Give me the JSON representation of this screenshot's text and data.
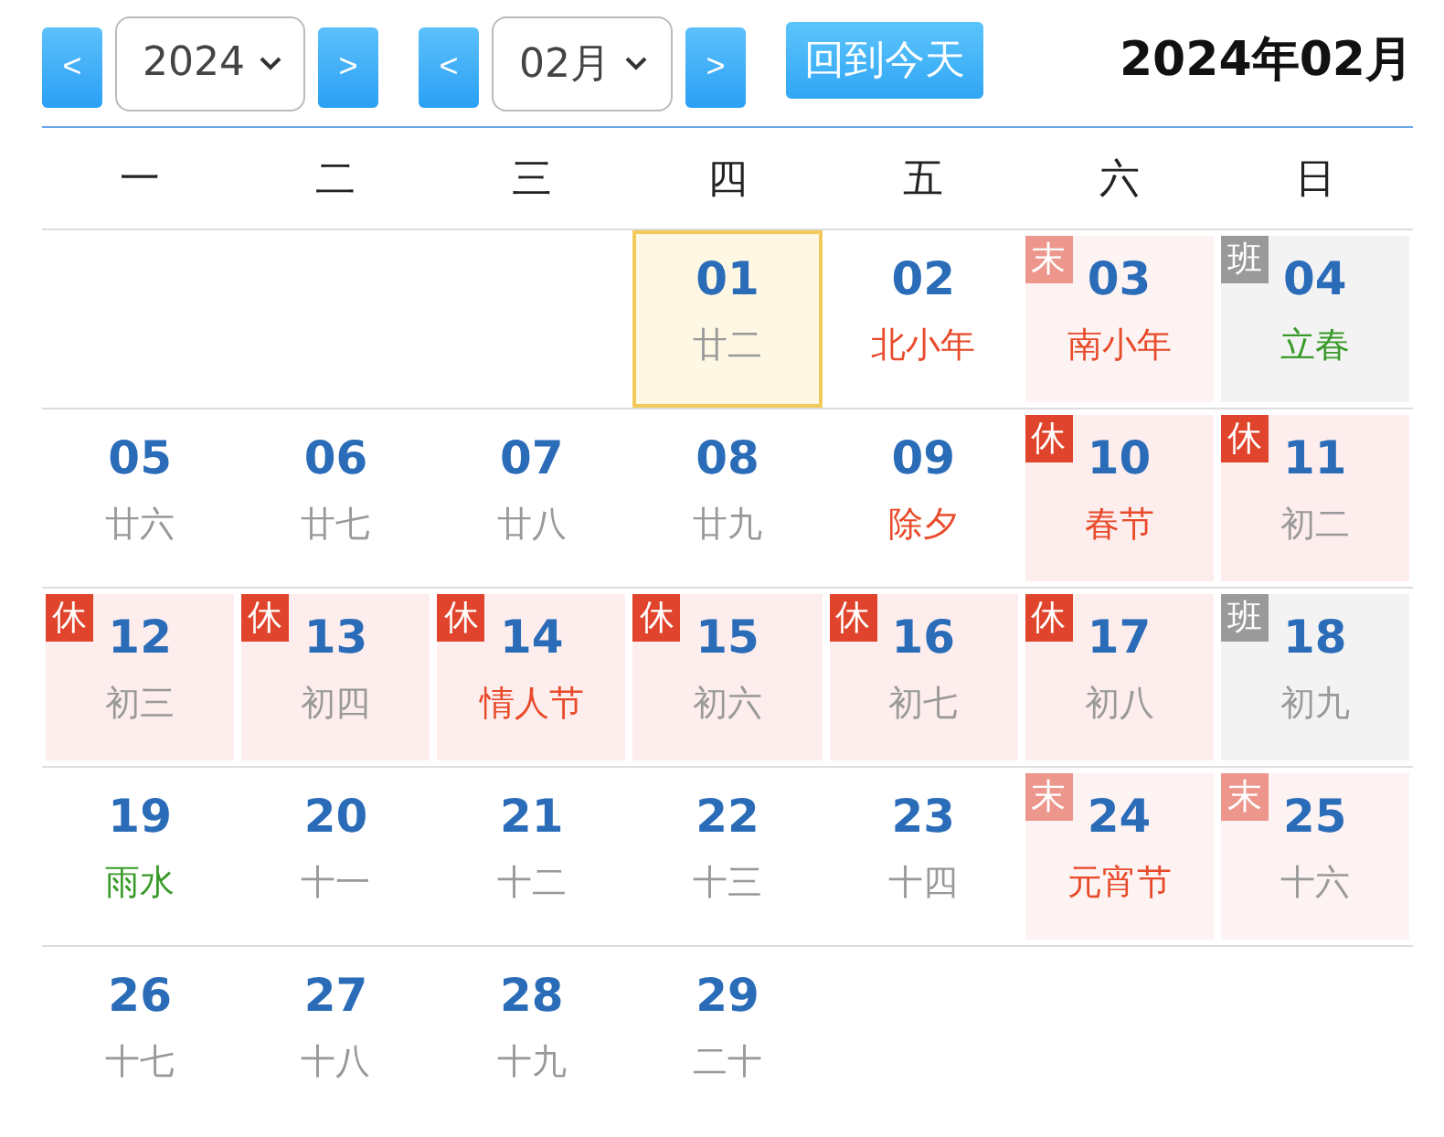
{
  "toolbar": {
    "year_select": {
      "value": "2024"
    },
    "month_select": {
      "value": "02月"
    },
    "prev_label": "<",
    "next_label": ">",
    "today_button": "回到今天",
    "heading": "2024年02月"
  },
  "weekdays": [
    "一",
    "二",
    "三",
    "四",
    "五",
    "六",
    "日"
  ],
  "weeks": [
    [
      {
        "date": "01",
        "sub": {
          "text": "廿二",
          "kind": "lunar"
        },
        "kind": "normal",
        "selected": true
      },
      {
        "date": "02",
        "sub": {
          "text": "北小年",
          "kind": "festival"
        },
        "kind": "normal",
        "selected": false
      },
      {
        "date": "03",
        "sub": {
          "text": "南小年",
          "kind": "festival"
        },
        "kind": "weekend",
        "badge": "末",
        "selected": false
      },
      {
        "date": "04",
        "sub": {
          "text": "立春",
          "kind": "term"
        },
        "kind": "work",
        "badge": "班",
        "selected": false
      }
    ],
    [
      {
        "date": "05",
        "sub": {
          "text": "廿六",
          "kind": "lunar"
        },
        "kind": "normal",
        "selected": false
      },
      {
        "date": "06",
        "sub": {
          "text": "廿七",
          "kind": "lunar"
        },
        "kind": "normal",
        "selected": false
      },
      {
        "date": "07",
        "sub": {
          "text": "廿八",
          "kind": "lunar"
        },
        "kind": "normal",
        "selected": false
      },
      {
        "date": "08",
        "sub": {
          "text": "廿九",
          "kind": "lunar"
        },
        "kind": "normal",
        "selected": false
      },
      {
        "date": "09",
        "sub": {
          "text": "除夕",
          "kind": "festival"
        },
        "kind": "normal",
        "selected": false
      },
      {
        "date": "10",
        "sub": {
          "text": "春节",
          "kind": "festival"
        },
        "kind": "rest",
        "badge": "休",
        "selected": false
      },
      {
        "date": "11",
        "sub": {
          "text": "初二",
          "kind": "lunar"
        },
        "kind": "rest",
        "badge": "休",
        "selected": false
      }
    ],
    [
      {
        "date": "12",
        "sub": {
          "text": "初三",
          "kind": "lunar"
        },
        "kind": "rest",
        "badge": "休",
        "selected": false
      },
      {
        "date": "13",
        "sub": {
          "text": "初四",
          "kind": "lunar"
        },
        "kind": "rest",
        "badge": "休",
        "selected": false
      },
      {
        "date": "14",
        "sub": {
          "text": "情人节",
          "kind": "festival"
        },
        "kind": "rest",
        "badge": "休",
        "selected": false
      },
      {
        "date": "15",
        "sub": {
          "text": "初六",
          "kind": "lunar"
        },
        "kind": "rest",
        "badge": "休",
        "selected": false
      },
      {
        "date": "16",
        "sub": {
          "text": "初七",
          "kind": "lunar"
        },
        "kind": "rest",
        "badge": "休",
        "selected": false
      },
      {
        "date": "17",
        "sub": {
          "text": "初八",
          "kind": "lunar"
        },
        "kind": "rest",
        "badge": "休",
        "selected": false
      },
      {
        "date": "18",
        "sub": {
          "text": "初九",
          "kind": "lunar"
        },
        "kind": "work",
        "badge": "班",
        "selected": false
      }
    ],
    [
      {
        "date": "19",
        "sub": {
          "text": "雨水",
          "kind": "term"
        },
        "kind": "normal",
        "selected": false
      },
      {
        "date": "20",
        "sub": {
          "text": "十一",
          "kind": "lunar"
        },
        "kind": "normal",
        "selected": false
      },
      {
        "date": "21",
        "sub": {
          "text": "十二",
          "kind": "lunar"
        },
        "kind": "normal",
        "selected": false
      },
      {
        "date": "22",
        "sub": {
          "text": "十三",
          "kind": "lunar"
        },
        "kind": "normal",
        "selected": false
      },
      {
        "date": "23",
        "sub": {
          "text": "十四",
          "kind": "lunar"
        },
        "kind": "normal",
        "selected": false
      },
      {
        "date": "24",
        "sub": {
          "text": "元宵节",
          "kind": "festival"
        },
        "kind": "weekend",
        "badge": "末",
        "selected": false
      },
      {
        "date": "25",
        "sub": {
          "text": "十六",
          "kind": "lunar"
        },
        "kind": "weekend",
        "badge": "末",
        "selected": false
      }
    ],
    [
      {
        "date": "26",
        "sub": {
          "text": "十七",
          "kind": "lunar"
        },
        "kind": "normal",
        "selected": false
      },
      {
        "date": "27",
        "sub": {
          "text": "十八",
          "kind": "lunar"
        },
        "kind": "normal",
        "selected": false
      },
      {
        "date": "28",
        "sub": {
          "text": "十九",
          "kind": "lunar"
        },
        "kind": "normal",
        "selected": false
      },
      {
        "date": "29",
        "sub": {
          "text": "二十",
          "kind": "lunar"
        },
        "kind": "normal",
        "selected": false
      }
    ]
  ]
}
